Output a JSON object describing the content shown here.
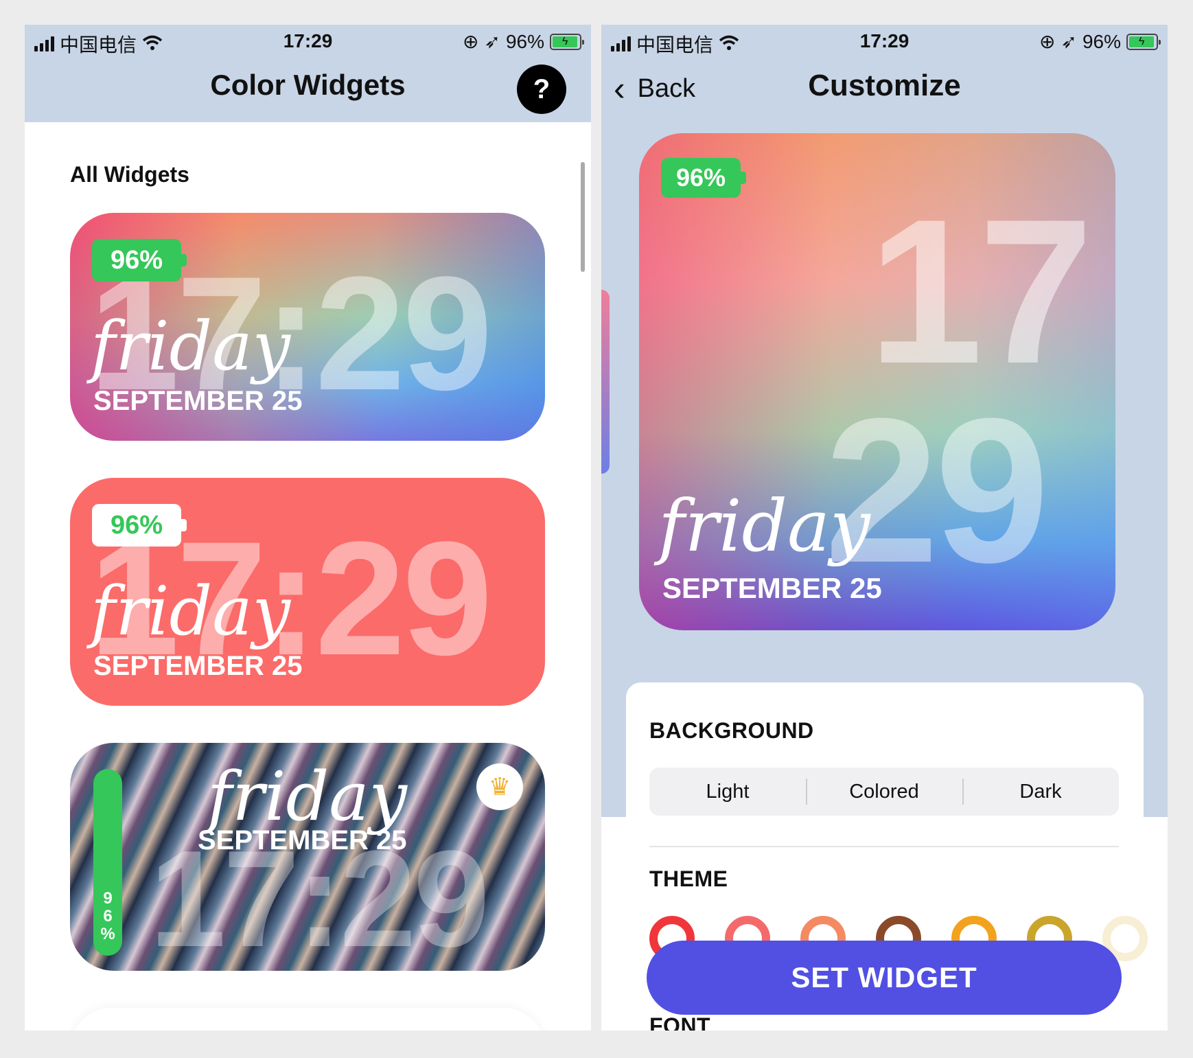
{
  "status_bar": {
    "carrier": "中国电信",
    "time": "17:29",
    "battery_text": "96%",
    "battery_level": 0.96
  },
  "left": {
    "title": "Color Widgets",
    "help_label": "?",
    "section_title": "All Widgets",
    "widgets": [
      {
        "battery": "96%",
        "time": "17:29",
        "day": "friday",
        "date": "SEPTEMBER 25"
      },
      {
        "battery": "96%",
        "time": "17:29",
        "day": "friday",
        "date": "SEPTEMBER 25"
      },
      {
        "battery": "9\n6\n%",
        "time": "17:29",
        "day": "friday",
        "date": "SEPTEMBER 25"
      }
    ]
  },
  "right": {
    "back_label": "Back",
    "title": "Customize",
    "preview": {
      "battery": "96%",
      "hour": "17",
      "minute": "29",
      "day": "friday",
      "date": "SEPTEMBER 25"
    },
    "background_label": "BACKGROUND",
    "background_options": [
      "Light",
      "Colored",
      "Dark"
    ],
    "theme_label": "THEME",
    "theme_colors": [
      "#f0363a",
      "#f46a6a",
      "#f48a62",
      "#8a4a2a",
      "#f3a21d",
      "#c9a52c",
      "#f2e3b8"
    ],
    "set_button": "SET WIDGET",
    "font_label": "FONT"
  },
  "colors": {
    "accent": "#5150e3",
    "battery_green": "#35c759",
    "header_bg": "#c8d5e6"
  }
}
